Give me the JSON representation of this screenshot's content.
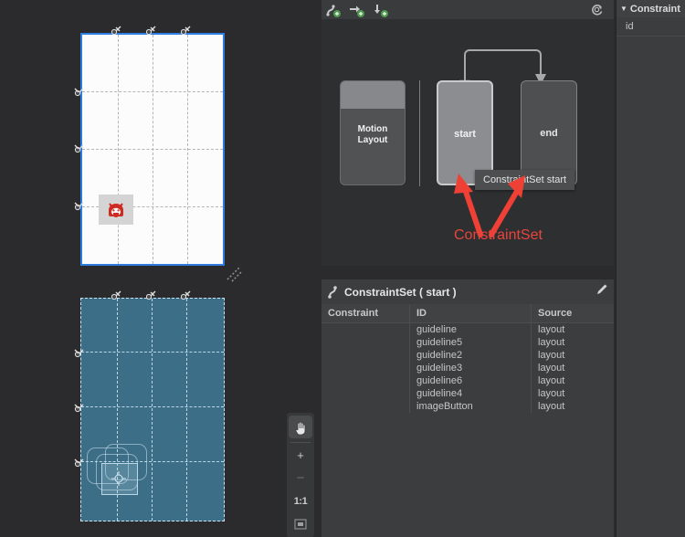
{
  "design_surface": {
    "name": "design-surface",
    "design_device": {
      "name": "design-view",
      "selected": true,
      "widgets": [
        {
          "id": "imageButton",
          "icon": "android-mascot-icon"
        }
      ],
      "guidelines": {
        "vertical": [
          "guideline",
          "guideline2",
          "guideline3"
        ],
        "horizontal": [
          "guideline4",
          "guideline5",
          "guideline6"
        ]
      }
    },
    "blueprint_device": {
      "name": "blueprint-view",
      "background_color": "#3c6e87",
      "widgets": [
        {
          "id": "imageButton"
        }
      ]
    },
    "zoom_controls": {
      "pan": "pan-tool",
      "zoom_in": "+",
      "zoom_out": "−",
      "actual_size": "1:1",
      "zoom_to_fit": "fit-screen"
    }
  },
  "motion_editor": {
    "toolbar": {
      "items": [
        {
          "name": "create-transition-button",
          "icon": "add-transition-icon"
        },
        {
          "name": "create-onclick-button",
          "icon": "add-arrow-icon"
        },
        {
          "name": "create-constraintset-button",
          "icon": "add-constraintset-icon"
        }
      ],
      "refresh": {
        "name": "cycle-states-button",
        "icon": "cycle-icon"
      }
    },
    "graph": {
      "motion_layout_node": {
        "label_line1": "Motion",
        "label_line2": "Layout"
      },
      "constraint_sets": [
        {
          "id": "start",
          "label": "start",
          "selected": true
        },
        {
          "id": "end",
          "label": "end",
          "selected": false
        }
      ],
      "transition": {
        "from": "start",
        "to": "end"
      },
      "tooltip": "ConstraintSet start",
      "annotation": {
        "text": "ConstraintSet",
        "color": "#e8453c"
      }
    },
    "constraintset_panel": {
      "title": "ConstraintSet ( start )",
      "edit_icon": "pencil-icon",
      "columns": [
        "Constraint",
        "ID",
        "Source"
      ],
      "rows": [
        {
          "constraint": "",
          "id": "guideline",
          "source": "layout"
        },
        {
          "constraint": "",
          "id": "guideline5",
          "source": "layout"
        },
        {
          "constraint": "",
          "id": "guideline2",
          "source": "layout"
        },
        {
          "constraint": "",
          "id": "guideline3",
          "source": "layout"
        },
        {
          "constraint": "",
          "id": "guideline6",
          "source": "layout"
        },
        {
          "constraint": "",
          "id": "guideline4",
          "source": "layout"
        },
        {
          "constraint": "",
          "id": "imageButton",
          "source": "layout"
        }
      ]
    }
  },
  "attributes_panel": {
    "section_title": "Constraint",
    "disclosure": "▼",
    "rows": [
      {
        "label": "id",
        "value": ""
      }
    ]
  }
}
